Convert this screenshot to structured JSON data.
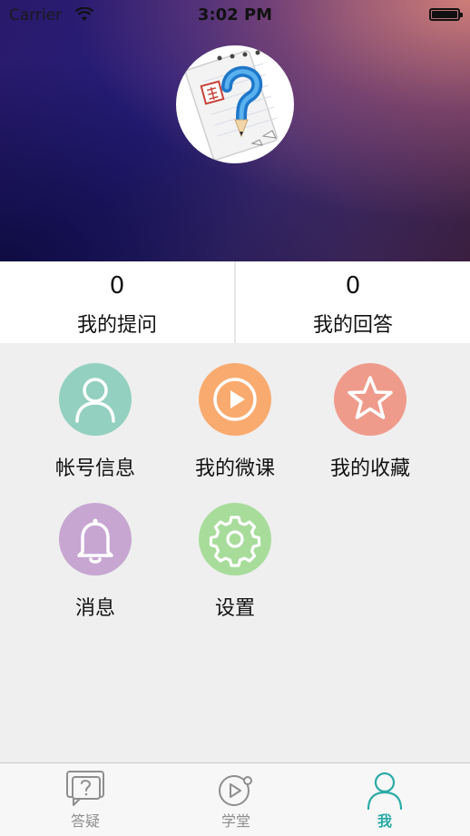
{
  "status_bar": {
    "carrier": "Carrier",
    "time": "3:02 PM"
  },
  "profile": {
    "avatar_icon": "question-mark-pencil-icon"
  },
  "stats": [
    {
      "value": "0",
      "label": "我的提问"
    },
    {
      "value": "0",
      "label": "我的回答"
    }
  ],
  "menu": [
    {
      "label": "帐号信息",
      "icon": "person-icon",
      "color": "#93d0bf"
    },
    {
      "label": "我的微课",
      "icon": "play-icon",
      "color": "#f9aa6e"
    },
    {
      "label": "我的收藏",
      "icon": "star-icon",
      "color": "#ef9b8b"
    },
    {
      "label": "消息",
      "icon": "bell-icon",
      "color": "#c7a6d2"
    },
    {
      "label": "设置",
      "icon": "gear-icon",
      "color": "#a8dc9b"
    }
  ],
  "tabbar": {
    "tabs": [
      {
        "label": "答疑",
        "icon": "chat-question-icon",
        "active": false
      },
      {
        "label": "学堂",
        "icon": "play-circle-icon",
        "active": false
      },
      {
        "label": "我",
        "icon": "person-outline-icon",
        "active": true
      }
    ],
    "active_color": "#2aaba6",
    "inactive_color": "#8e8e8e"
  }
}
